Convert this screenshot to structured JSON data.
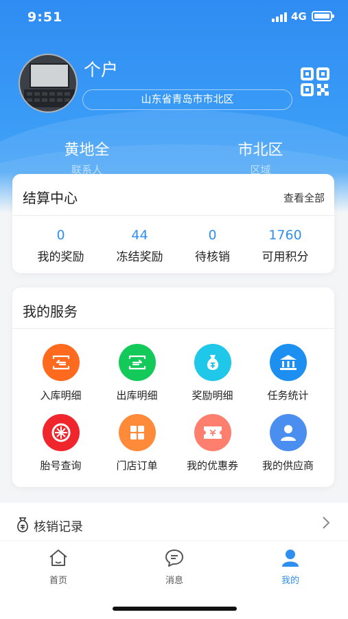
{
  "status_bar": {
    "time": "9:51",
    "network": "4G"
  },
  "profile": {
    "user_type": "个户",
    "address": "山东省青岛市市北区"
  },
  "contacts": [
    {
      "value": "黄地全",
      "label": "联系人"
    },
    {
      "value": "市北区",
      "label": "区域"
    }
  ],
  "settlement": {
    "title": "结算中心",
    "view_all": "查看全部",
    "stats": [
      {
        "value": "0",
        "label": "我的奖励"
      },
      {
        "value": "44",
        "label": "冻结奖励"
      },
      {
        "value": "0",
        "label": "待核销"
      },
      {
        "value": "1760",
        "label": "可用积分"
      }
    ]
  },
  "services": {
    "title": "我的服务",
    "items": [
      {
        "label": "入库明细",
        "icon": "inbound-icon",
        "color": "#ff6a1f"
      },
      {
        "label": "出库明细",
        "icon": "outbound-icon",
        "color": "#12c95a"
      },
      {
        "label": "奖励明细",
        "icon": "money-bag-icon",
        "color": "#1fc7e8"
      },
      {
        "label": "任务统计",
        "icon": "building-icon",
        "color": "#1d8ff0"
      },
      {
        "label": "胎号查询",
        "icon": "tire-icon",
        "color": "#f0262d"
      },
      {
        "label": "门店订单",
        "icon": "grid-icon",
        "color": "#ff8a3a"
      },
      {
        "label": "我的优惠券",
        "icon": "coupon-icon",
        "color": "#ff7f6e"
      },
      {
        "label": "我的供应商",
        "icon": "person-icon",
        "color": "#4a8ef0"
      }
    ]
  },
  "record": {
    "label": "核销记录"
  },
  "tabs": [
    {
      "label": "首页",
      "icon": "home-icon"
    },
    {
      "label": "消息",
      "icon": "message-icon"
    },
    {
      "label": "我的",
      "icon": "user-icon",
      "active": true
    }
  ],
  "colors": {
    "accent": "#2e8ff0",
    "header": "#3a9bf6"
  }
}
